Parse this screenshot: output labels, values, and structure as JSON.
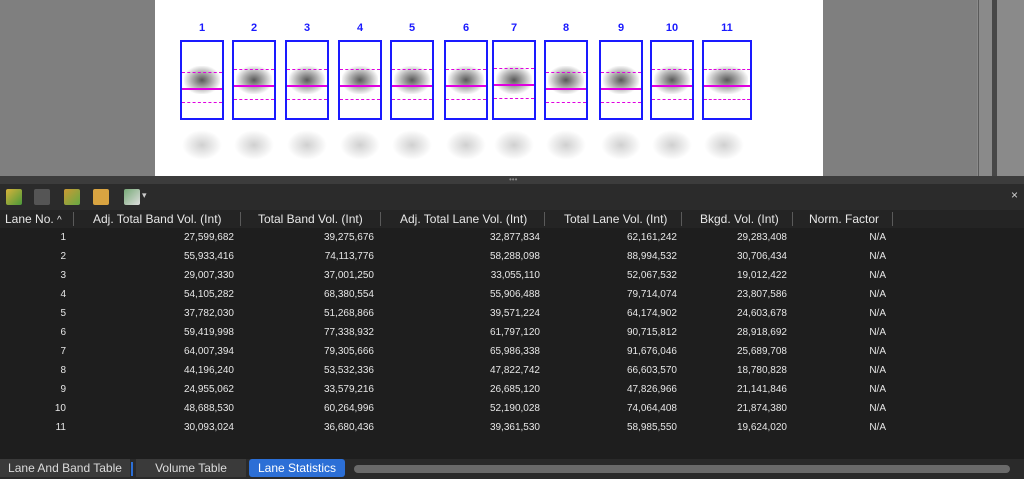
{
  "lanes": [
    "1",
    "2",
    "3",
    "4",
    "5",
    "6",
    "7",
    "8",
    "9",
    "10",
    "11"
  ],
  "table": {
    "columns": [
      "Lane No.",
      "Adj. Total Band Vol. (Int)",
      "Total Band Vol. (Int)",
      "Adj. Total Lane Vol. (Int)",
      "Total Lane Vol. (Int)",
      "Bkgd. Vol. (Int)",
      "Norm. Factor"
    ],
    "sort_indicator": "^",
    "rows": [
      [
        "1",
        "27,599,682",
        "39,275,676",
        "32,877,834",
        "62,161,242",
        "29,283,408",
        "N/A"
      ],
      [
        "2",
        "55,933,416",
        "74,113,776",
        "58,288,098",
        "88,994,532",
        "30,706,434",
        "N/A"
      ],
      [
        "3",
        "29,007,330",
        "37,001,250",
        "33,055,110",
        "52,067,532",
        "19,012,422",
        "N/A"
      ],
      [
        "4",
        "54,105,282",
        "68,380,554",
        "55,906,488",
        "79,714,074",
        "23,807,586",
        "N/A"
      ],
      [
        "5",
        "37,782,030",
        "51,268,866",
        "39,571,224",
        "64,174,902",
        "24,603,678",
        "N/A"
      ],
      [
        "6",
        "59,419,998",
        "77,338,932",
        "61,797,120",
        "90,715,812",
        "28,918,692",
        "N/A"
      ],
      [
        "7",
        "64,007,394",
        "79,305,666",
        "65,986,338",
        "91,676,046",
        "25,689,708",
        "N/A"
      ],
      [
        "8",
        "44,196,240",
        "53,532,336",
        "47,822,742",
        "66,603,570",
        "18,780,828",
        "N/A"
      ],
      [
        "9",
        "24,955,062",
        "33,579,216",
        "26,685,120",
        "47,826,966",
        "21,141,846",
        "N/A"
      ],
      [
        "10",
        "48,688,530",
        "60,264,996",
        "52,190,028",
        "74,064,408",
        "21,874,380",
        "N/A"
      ],
      [
        "11",
        "30,093,024",
        "36,680,436",
        "39,361,530",
        "58,985,550",
        "19,624,020",
        "N/A"
      ]
    ]
  },
  "tabs": [
    "Lane And Band Table",
    "Volume Table",
    "Lane Statistics"
  ],
  "close_glyph": "×",
  "colors": {
    "lane_box": "#1a1aff",
    "band_line": "#e000e0",
    "active_tab": "#2c6fd6"
  }
}
